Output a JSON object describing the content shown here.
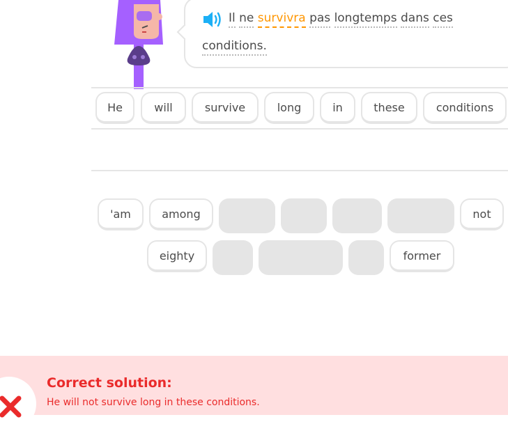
{
  "prompt": {
    "audio_icon": "speaker-icon",
    "sentence_line1": [
      "Il",
      "ne",
      "survivra",
      "pas",
      "longtemps",
      "dans",
      "ces"
    ],
    "sentence_line2": [
      "conditions."
    ],
    "highlight_word": "survivra"
  },
  "answer_tiles": [
    "He",
    "will",
    "survive",
    "long",
    "in",
    "these",
    "conditions"
  ],
  "word_bank": {
    "row1": [
      "'am",
      "among",
      "not"
    ],
    "row2": [
      "eighty",
      "former"
    ]
  },
  "feedback": {
    "title": "Correct solution:",
    "text": "He will not survive long in these conditions.",
    "icon": "close-icon"
  },
  "colors": {
    "highlight": "#ff9600",
    "error": "#ea2b2b",
    "footer_bg": "#ffdfe0",
    "character": "#a560ff"
  }
}
